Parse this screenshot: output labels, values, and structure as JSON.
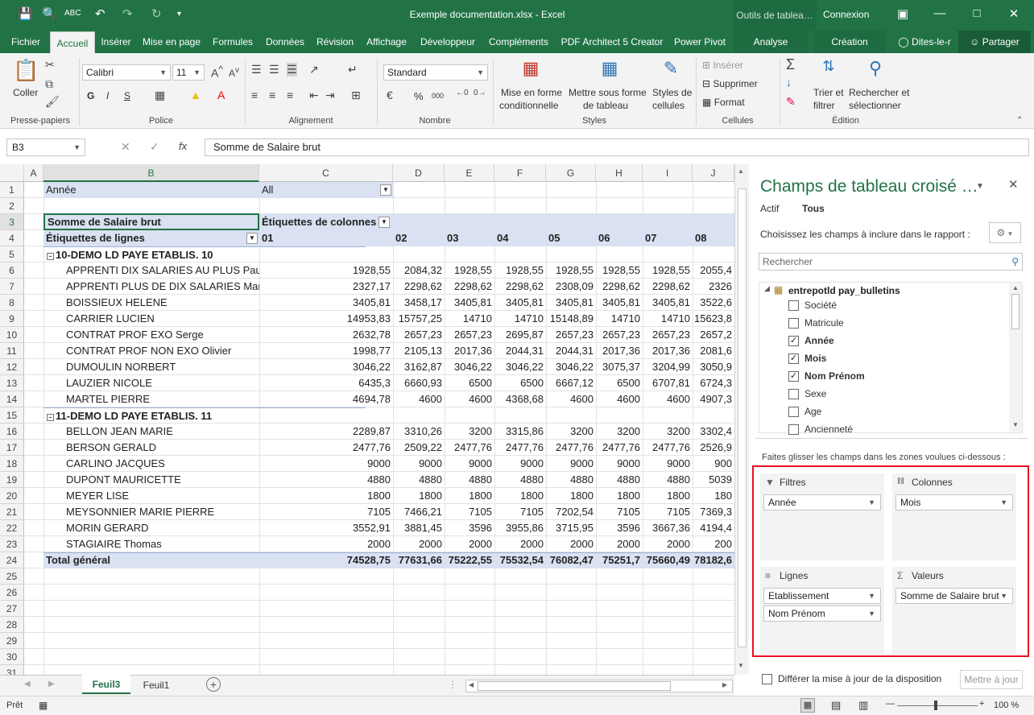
{
  "title_bar": {
    "document_title": "Exemple documentation.xlsx  -  Excel",
    "context_tools": "Outils de tablea…",
    "login": "Connexion"
  },
  "tabs": [
    {
      "label": "Fichier"
    },
    {
      "label": "Accueil"
    },
    {
      "label": "Insérer"
    },
    {
      "label": "Mise en page"
    },
    {
      "label": "Formules"
    },
    {
      "label": "Données"
    },
    {
      "label": "Révision"
    },
    {
      "label": "Affichage"
    },
    {
      "label": "Développeur"
    },
    {
      "label": "Compléments"
    },
    {
      "label": "PDF Architect 5 Creator"
    },
    {
      "label": "Power Pivot"
    },
    {
      "label": "Analyse"
    },
    {
      "label": "Création"
    }
  ],
  "tellme": "Dites-le-r",
  "share": "Partager",
  "ribbon": {
    "clipboard": {
      "paste": "Coller",
      "group": "Presse-papiers"
    },
    "font": {
      "name": "Calibri",
      "size": "11",
      "bold": "G",
      "italic": "I",
      "underline": "S",
      "group": "Police"
    },
    "alignment": {
      "group": "Alignement"
    },
    "number": {
      "format": "Standard",
      "percent": "%",
      "thousands": "000",
      "group": "Nombre"
    },
    "styles": {
      "conditional": "Mise en forme",
      "conditional2": "conditionnelle",
      "table": "Mettre sous forme",
      "table2": "de tableau",
      "cell": "Styles de",
      "cell2": "cellules",
      "group": "Styles"
    },
    "cells": {
      "insert": "Insérer",
      "delete": "Supprimer",
      "format": "Format",
      "group": "Cellules"
    },
    "editing": {
      "sort": "Trier et",
      "sort2": "filtrer",
      "find": "Rechercher et",
      "find2": "sélectionner",
      "group": "Édition"
    }
  },
  "formula_bar": {
    "name_box": "B3",
    "fx": "fx",
    "content": "Somme de Salaire brut"
  },
  "grid": {
    "columns": [
      "A",
      "B",
      "C",
      "D",
      "E",
      "F",
      "G",
      "H",
      "I",
      "J"
    ],
    "r1": {
      "label": "Année",
      "value": "All"
    },
    "r3": {
      "b": "Somme de Salaire brut",
      "c": "Étiquettes de colonnes"
    },
    "r4": {
      "b": "Étiquettes de lignes",
      "months": [
        "01",
        "02",
        "03",
        "04",
        "05",
        "06",
        "07",
        "08"
      ]
    },
    "groups": [
      {
        "label": "10-DEMO LD PAYE ETABLIS. 10"
      },
      {
        "label": "11-DEMO LD PAYE ETABLIS. 11"
      }
    ],
    "rows": [
      {
        "n": "6",
        "name": "APPRENTI DIX SALARIES AU PLUS Paul",
        "v": [
          "1928,55",
          "2084,32",
          "1928,55",
          "1928,55",
          "1928,55",
          "1928,55",
          "1928,55",
          "2055,4"
        ]
      },
      {
        "n": "7",
        "name": "APPRENTI PLUS DE DIX SALARIES Marc",
        "v": [
          "2327,17",
          "2298,62",
          "2298,62",
          "2298,62",
          "2308,09",
          "2298,62",
          "2298,62",
          "2326"
        ]
      },
      {
        "n": "8",
        "name": "BOISSIEUX HELENE",
        "v": [
          "3405,81",
          "3458,17",
          "3405,81",
          "3405,81",
          "3405,81",
          "3405,81",
          "3405,81",
          "3522,6"
        ]
      },
      {
        "n": "9",
        "name": "CARRIER LUCIEN",
        "v": [
          "14953,83",
          "15757,25",
          "14710",
          "14710",
          "15148,89",
          "14710",
          "14710",
          "15623,8"
        ]
      },
      {
        "n": "10",
        "name": "CONTRAT PROF EXO Serge",
        "v": [
          "2632,78",
          "2657,23",
          "2657,23",
          "2695,87",
          "2657,23",
          "2657,23",
          "2657,23",
          "2657,2"
        ]
      },
      {
        "n": "11",
        "name": "CONTRAT PROF NON EXO Olivier",
        "v": [
          "1998,77",
          "2105,13",
          "2017,36",
          "2044,31",
          "2044,31",
          "2017,36",
          "2017,36",
          "2081,6"
        ]
      },
      {
        "n": "12",
        "name": "DUMOULIN NORBERT",
        "v": [
          "3046,22",
          "3162,87",
          "3046,22",
          "3046,22",
          "3046,22",
          "3075,37",
          "3204,99",
          "3050,9"
        ]
      },
      {
        "n": "13",
        "name": "LAUZIER NICOLE",
        "v": [
          "6435,3",
          "6660,93",
          "6500",
          "6500",
          "6667,12",
          "6500",
          "6707,81",
          "6724,3"
        ]
      },
      {
        "n": "14",
        "name": "MARTEL PIERRE",
        "v": [
          "4694,78",
          "4600",
          "4600",
          "4368,68",
          "4600",
          "4600",
          "4600",
          "4907,3"
        ]
      },
      {
        "n": "16",
        "name": "BELLON JEAN MARIE",
        "v": [
          "2289,87",
          "3310,26",
          "3200",
          "3315,86",
          "3200",
          "3200",
          "3200",
          "3302,4"
        ]
      },
      {
        "n": "17",
        "name": "BERSON GERALD",
        "v": [
          "2477,76",
          "2509,22",
          "2477,76",
          "2477,76",
          "2477,76",
          "2477,76",
          "2477,76",
          "2526,9"
        ]
      },
      {
        "n": "18",
        "name": "CARLINO JACQUES",
        "v": [
          "9000",
          "9000",
          "9000",
          "9000",
          "9000",
          "9000",
          "9000",
          "900"
        ]
      },
      {
        "n": "19",
        "name": "DUPONT MAURICETTE",
        "v": [
          "4880",
          "4880",
          "4880",
          "4880",
          "4880",
          "4880",
          "4880",
          "5039"
        ]
      },
      {
        "n": "20",
        "name": "MEYER LISE",
        "v": [
          "1800",
          "1800",
          "1800",
          "1800",
          "1800",
          "1800",
          "1800",
          "180"
        ]
      },
      {
        "n": "21",
        "name": "MEYSONNIER MARIE PIERRE",
        "v": [
          "7105",
          "7466,21",
          "7105",
          "7105",
          "7202,54",
          "7105",
          "7105",
          "7369,3"
        ]
      },
      {
        "n": "22",
        "name": "MORIN GERARD",
        "v": [
          "3552,91",
          "3881,45",
          "3596",
          "3955,86",
          "3715,95",
          "3596",
          "3667,36",
          "4194,4"
        ]
      },
      {
        "n": "23",
        "name": "STAGIAIRE Thomas",
        "v": [
          "2000",
          "2000",
          "2000",
          "2000",
          "2000",
          "2000",
          "2000",
          "200"
        ]
      }
    ],
    "total": {
      "label": "Total général",
      "v": [
        "74528,75",
        "77631,66",
        "75222,55",
        "75532,54",
        "76082,47",
        "75251,7",
        "75660,49",
        "78182,6"
      ]
    },
    "row_numbers": [
      "1",
      "2",
      "3",
      "4",
      "5",
      "6",
      "7",
      "8",
      "9",
      "10",
      "11",
      "12",
      "13",
      "14",
      "15",
      "16",
      "17",
      "18",
      "19",
      "20",
      "21",
      "22",
      "23",
      "24",
      "25",
      "26",
      "27",
      "28",
      "29",
      "30",
      "31"
    ]
  },
  "sheets": {
    "active": "Feuil3",
    "other": "Feuil1"
  },
  "status": {
    "ready": "Prêt",
    "zoom": "100 %"
  },
  "pane": {
    "title": "Champs de tableau croisé …",
    "tab_active": "Actif",
    "tab_all": "Tous",
    "instruction": "Choisissez les champs à inclure dans le rapport :",
    "search_placeholder": "Rechercher",
    "table_name": "entrepotld pay_bulletins",
    "fields": [
      {
        "label": "Société",
        "checked": false
      },
      {
        "label": "Matricule",
        "checked": false
      },
      {
        "label": "Année",
        "checked": true
      },
      {
        "label": "Mois",
        "checked": true
      },
      {
        "label": "Nom Prénom",
        "checked": true
      },
      {
        "label": "Sexe",
        "checked": false
      },
      {
        "label": "Age",
        "checked": false
      },
      {
        "label": "Ancienneté",
        "checked": false
      }
    ],
    "drag_hint": "Faites glisser les champs dans les zones voulues ci-dessous :",
    "zones": {
      "filters": {
        "title": "Filtres",
        "items": [
          "Année"
        ]
      },
      "columns": {
        "title": "Colonnes",
        "items": [
          "Mois"
        ]
      },
      "rows": {
        "title": "Lignes",
        "items": [
          "Etablissement",
          "Nom Prénom"
        ]
      },
      "values": {
        "title": "Valeurs",
        "items": [
          "Somme de Salaire brut"
        ]
      }
    },
    "defer": "Différer la mise à jour de la disposition",
    "update": "Mettre à jour",
    "highlight_color": "#e81123"
  }
}
